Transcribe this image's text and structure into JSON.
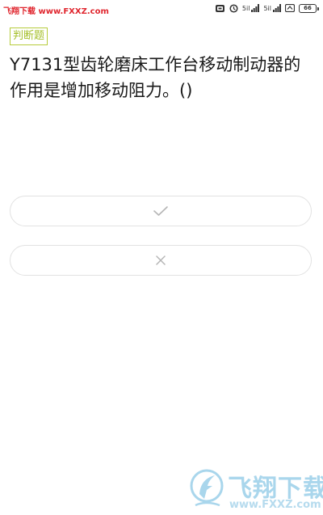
{
  "status_bar": {
    "watermark_text": "飞翔下载 www.FXXZ.com",
    "signal_1": "5il",
    "signal_2": "5il",
    "battery": "66"
  },
  "question": {
    "type_tag": "判断题",
    "text": "Y7131型齿轮磨床工作台移动制动器的作用是增加移动阻力。()"
  },
  "options": [
    {
      "icon": "check-icon"
    },
    {
      "icon": "cross-icon"
    }
  ],
  "logo": {
    "text": "飞翔下载",
    "url": "www.FXXZ.com"
  },
  "colors": {
    "watermark": "#e0262e",
    "tag": "#a6c02c",
    "option_border": "#e2e2e2",
    "logo": "#a9d6ec"
  }
}
